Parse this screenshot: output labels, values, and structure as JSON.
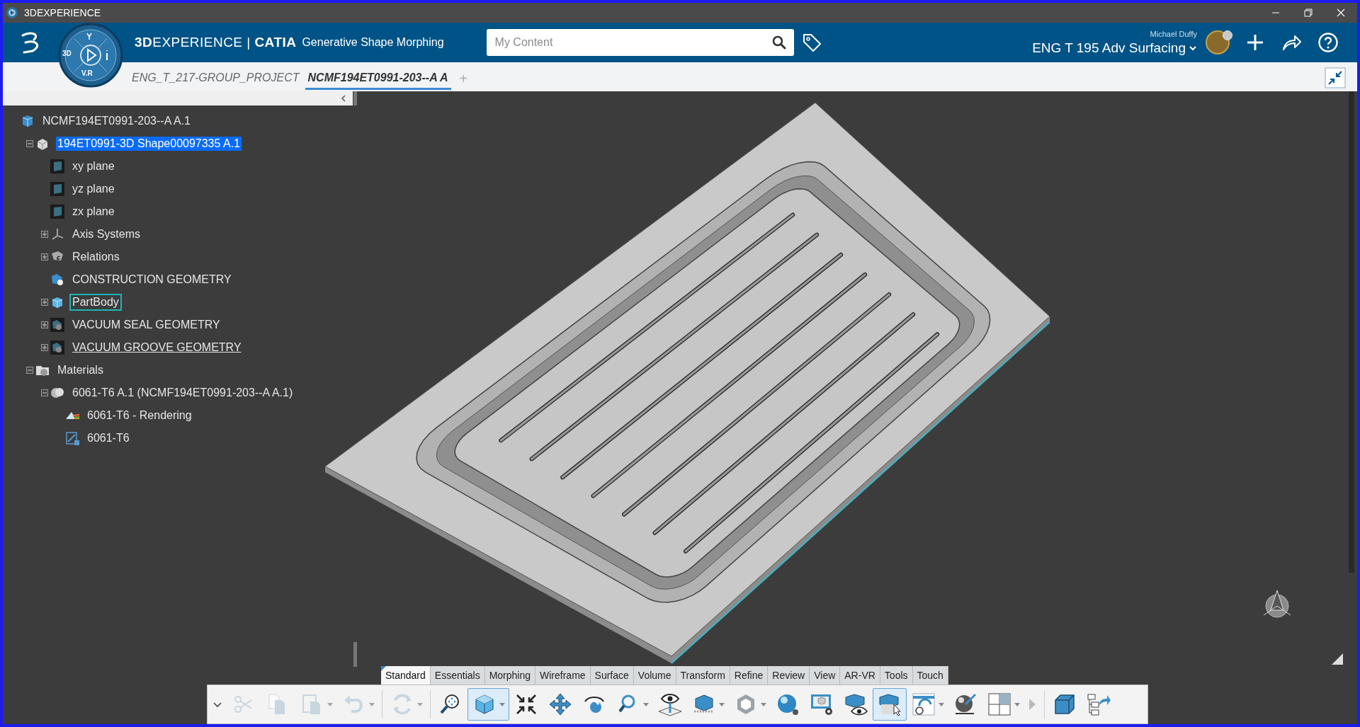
{
  "window": {
    "title": "3DEXPERIENCE"
  },
  "header": {
    "brand": "**3D**EXPERIENCE | **CATIA**",
    "app": "Generative Shape Morphing",
    "compass": {
      "left": "3D",
      "bottom": "V.R"
    },
    "search": {
      "placeholder": "My Content"
    },
    "user": "Michael Duffy",
    "collaborative_space": "ENG T 195 Adv Surfacing"
  },
  "tabs": [
    {
      "label": "ENG_T_217-GROUP_PROJECT",
      "selected": false
    },
    {
      "label": "NCMF194ET0991-203--A A",
      "selected": true
    }
  ],
  "add_tab": "+",
  "tree": [
    {
      "kind": "product",
      "label": "NCMF194ET0991-203--A A.1",
      "selected": false,
      "current": false,
      "underlined": false,
      "children": [
        {
          "kind": "part",
          "label": "194ET0991-3D Shape00097335 A.1",
          "selected": true,
          "current": false,
          "underlined": false,
          "expanded": true,
          "children": [
            {
              "kind": "plane",
              "label": "xy plane",
              "selected": false,
              "current": false,
              "underlined": false
            },
            {
              "kind": "plane",
              "label": "yz plane",
              "selected": false,
              "current": false,
              "underlined": false
            },
            {
              "kind": "plane",
              "label": "zx plane",
              "selected": false,
              "current": false,
              "underlined": false
            },
            {
              "kind": "axis",
              "label": "Axis Systems",
              "selected": false,
              "current": false,
              "underlined": false,
              "expanded": false
            },
            {
              "kind": "relations",
              "label": "Relations",
              "selected": false,
              "current": false,
              "underlined": false,
              "expanded": false
            },
            {
              "kind": "geoset",
              "label": "CONSTRUCTION GEOMETRY",
              "selected": false,
              "current": false,
              "underlined": false
            },
            {
              "kind": "body",
              "label": "PartBody",
              "selected": false,
              "current": true,
              "underlined": false,
              "expanded": false
            },
            {
              "kind": "geoset-dark",
              "label": "VACUUM SEAL GEOMETRY",
              "selected": false,
              "current": false,
              "underlined": false,
              "expanded": false
            },
            {
              "kind": "geoset-dark",
              "label": "VACUUM GROOVE GEOMETRY",
              "selected": false,
              "current": false,
              "underlined": true,
              "expanded": false
            }
          ]
        },
        {
          "kind": "materials",
          "label": "Materials",
          "selected": false,
          "current": false,
          "underlined": false,
          "expanded": true,
          "children": [
            {
              "kind": "material",
              "label": "6061-T6 A.1 (NCMF194ET0991-203--A A.1)",
              "selected": false,
              "current": false,
              "underlined": false,
              "expanded": true,
              "children": [
                {
                  "kind": "rendering",
                  "label": "6061-T6 - Rendering",
                  "selected": false,
                  "current": false,
                  "underlined": false
                },
                {
                  "kind": "domain",
                  "label": "6061-T6",
                  "selected": false,
                  "current": false,
                  "underlined": false
                }
              ]
            }
          ]
        }
      ]
    }
  ],
  "action_tabs": [
    {
      "label": "Standard",
      "selected": true
    },
    {
      "label": "Essentials",
      "selected": false
    },
    {
      "label": "Morphing",
      "selected": false
    },
    {
      "label": "Wireframe",
      "selected": false
    },
    {
      "label": "Surface",
      "selected": false
    },
    {
      "label": "Volume",
      "selected": false
    },
    {
      "label": "Transform",
      "selected": false
    },
    {
      "label": "Refine",
      "selected": false
    },
    {
      "label": "Review",
      "selected": false
    },
    {
      "label": "View",
      "selected": false
    },
    {
      "label": "AR-VR",
      "selected": false
    },
    {
      "label": "Tools",
      "selected": false
    },
    {
      "label": "Touch",
      "selected": false
    }
  ],
  "toolbar": [
    {
      "tools": [
        {
          "kind": "cut",
          "dropdown": false,
          "selected": false,
          "disabled": true
        },
        {
          "kind": "copy",
          "dropdown": false,
          "selected": false,
          "disabled": true
        },
        {
          "kind": "paste",
          "dropdown": true,
          "selected": false,
          "disabled": true
        },
        {
          "kind": "undo",
          "dropdown": true,
          "selected": false,
          "disabled": true
        }
      ]
    },
    {
      "tools": [
        {
          "kind": "update",
          "dropdown": true,
          "selected": false,
          "disabled": true
        }
      ]
    },
    {
      "tools": [
        {
          "kind": "magnifier",
          "dropdown": false,
          "selected": false,
          "disabled": false
        },
        {
          "kind": "cube",
          "dropdown": true,
          "selected": true,
          "disabled": false
        },
        {
          "kind": "fit",
          "dropdown": false,
          "selected": false,
          "disabled": false
        },
        {
          "kind": "pan",
          "dropdown": false,
          "selected": false,
          "disabled": false
        },
        {
          "kind": "rotate",
          "dropdown": false,
          "selected": false,
          "disabled": false
        },
        {
          "kind": "zoom",
          "dropdown": true,
          "selected": false,
          "disabled": false
        },
        {
          "kind": "eye-plane",
          "dropdown": false,
          "selected": false,
          "disabled": false
        },
        {
          "kind": "view-cube",
          "dropdown": true,
          "selected": false,
          "disabled": false
        },
        {
          "kind": "hexagon",
          "dropdown": true,
          "selected": false,
          "disabled": false
        },
        {
          "kind": "sphere",
          "dropdown": false,
          "selected": false,
          "disabled": false
        },
        {
          "kind": "screen-gear",
          "dropdown": false,
          "selected": false,
          "disabled": false
        },
        {
          "kind": "cube-eye",
          "dropdown": false,
          "selected": false,
          "disabled": false
        },
        {
          "kind": "cube-cursor",
          "dropdown": false,
          "selected": true,
          "disabled": false
        },
        {
          "kind": "refresh-window",
          "dropdown": true,
          "selected": false,
          "disabled": false
        },
        {
          "kind": "sphere-pen",
          "dropdown": false,
          "selected": false,
          "disabled": false
        },
        {
          "kind": "grid",
          "dropdown": true,
          "selected": false,
          "disabled": false
        },
        {
          "kind": "more",
          "dropdown": false,
          "selected": false,
          "disabled": false
        }
      ]
    },
    {
      "tools": [
        {
          "kind": "cube-outline",
          "dropdown": false,
          "selected": false,
          "disabled": false
        },
        {
          "kind": "export",
          "dropdown": false,
          "selected": false,
          "disabled": false
        }
      ]
    }
  ]
}
